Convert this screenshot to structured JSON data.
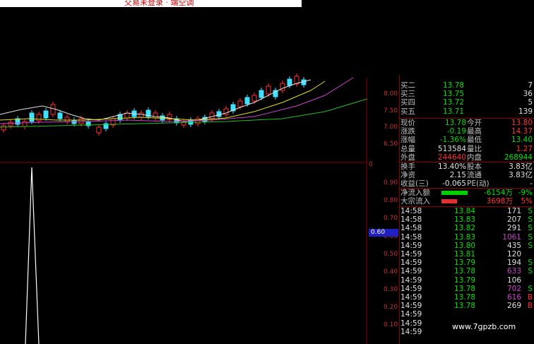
{
  "title_bar": {
    "text": "交易未登录 · 端空调"
  },
  "axis": {
    "upper_ticks": [
      "8.00",
      "7.50",
      "7.00",
      "6.50"
    ],
    "zero_marker": "0",
    "lower_ticks": [
      "0.90",
      "0.80",
      "0.70",
      "0.60",
      "0.50",
      "0.40",
      "0.30",
      "0.20",
      "0.10"
    ],
    "cursor_value": "0.60"
  },
  "quote": {
    "asks": [
      {
        "label": "买二",
        "price": "13.78",
        "vol": "7"
      },
      {
        "label": "买三",
        "price": "13.75",
        "vol": "36"
      },
      {
        "label": "买四",
        "price": "13.72",
        "vol": "5"
      },
      {
        "label": "买五",
        "price": "13.71",
        "vol": "139"
      }
    ],
    "stats": [
      {
        "l1": "现价",
        "v1": "13.78",
        "l2": "今开",
        "v2": "13.80",
        "c1": "g",
        "c2": "r"
      },
      {
        "l1": "涨跌",
        "v1": "-0.19",
        "l2": "最高",
        "v2": "14.37",
        "c1": "g",
        "c2": "r"
      },
      {
        "l1": "涨幅",
        "v1": "-1.36%",
        "l2": "最低",
        "v2": "13.40",
        "c1": "g",
        "c2": "g"
      },
      {
        "l1": "总量",
        "v1": "513584",
        "l2": "量比",
        "v2": "1.27",
        "c1": "w",
        "c2": "r"
      },
      {
        "l1": "外盘",
        "v1": "244640",
        "l2": "内盘",
        "v2": "268944",
        "c1": "r",
        "c2": "g"
      }
    ],
    "finance": [
      {
        "l1": "换手",
        "v1": "13.40%",
        "l2": "股本",
        "v2": "3.83亿"
      },
      {
        "l1": "净资",
        "v1": "2.15",
        "l2": "流通",
        "v2": "3.83亿"
      },
      {
        "l1": "收益(三)",
        "v1": "-0.065",
        "l2": "PE(动)",
        "v2": "-"
      }
    ],
    "flow": [
      {
        "label": "净流入额",
        "value": "-6154万",
        "pct": "-9%",
        "color": "#00d000",
        "fill": 0.46
      },
      {
        "label": "大宗流入",
        "value": "3698万",
        "pct": "5%",
        "color": "#e03030",
        "fill": 0.27
      }
    ],
    "ticks": [
      {
        "time": "14:58",
        "price": "13.84",
        "vol": "171",
        "bs": "S",
        "vc": "w"
      },
      {
        "time": "14:58",
        "price": "13.83",
        "vol": "207",
        "bs": "S",
        "vc": "w"
      },
      {
        "time": "14:58",
        "price": "13.82",
        "vol": "291",
        "bs": "S",
        "vc": "w"
      },
      {
        "time": "14:58",
        "price": "13.83",
        "vol": "1061",
        "bs": "S",
        "vc": "m"
      },
      {
        "time": "14:59",
        "price": "13.80",
        "vol": "435",
        "bs": "S",
        "vc": "w"
      },
      {
        "time": "14:59",
        "price": "13.81",
        "vol": "120",
        "bs": "",
        "vc": "w"
      },
      {
        "time": "14:59",
        "price": "13.79",
        "vol": "194",
        "bs": "S",
        "vc": "w"
      },
      {
        "time": "14:59",
        "price": "13.78",
        "vol": "633",
        "bs": "S",
        "vc": "m"
      },
      {
        "time": "14:59",
        "price": "13.79",
        "vol": "106",
        "bs": "",
        "vc": "w"
      },
      {
        "time": "14:59",
        "price": "13.78",
        "vol": "702",
        "bs": "S",
        "vc": "m"
      },
      {
        "time": "14:59",
        "price": "13.78",
        "vol": "616",
        "bs": "B",
        "vc": "m"
      },
      {
        "time": "14:59",
        "price": "13.78",
        "vol": "269",
        "bs": "B",
        "vc": "w"
      },
      {
        "time": "14:59",
        "price": "",
        "vol": "",
        "bs": "",
        "vc": "w"
      },
      {
        "time": "14:59",
        "price": "",
        "vol": "",
        "bs": "",
        "vc": "w"
      },
      {
        "time": "14:59",
        "price": "",
        "vol": "",
        "bs": "",
        "vc": "w"
      }
    ]
  },
  "watermark": "www.7gpzb.com",
  "colors": {
    "up": "#ff3030",
    "down": "#00e000",
    "grid": "#8b0000",
    "cyan": "#40e0ff"
  }
}
